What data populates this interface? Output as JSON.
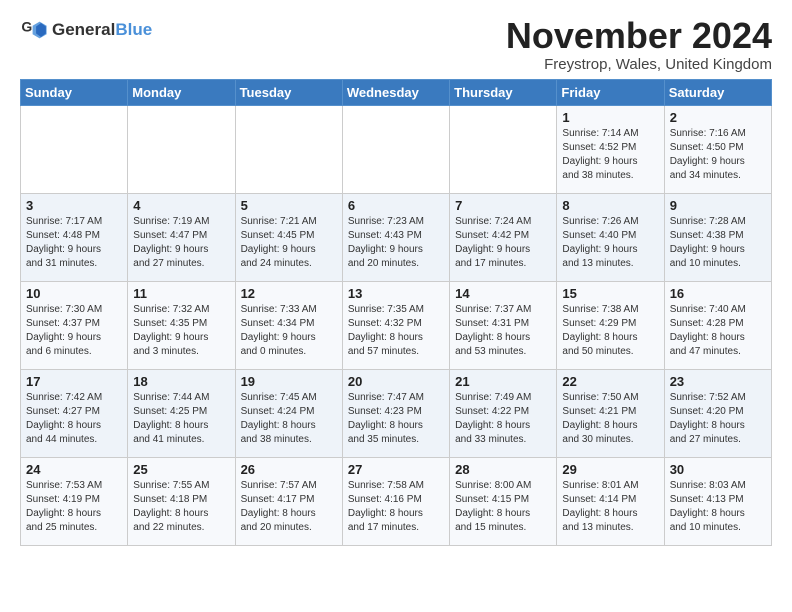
{
  "logo": {
    "line1": "General",
    "line2": "Blue"
  },
  "title": "November 2024",
  "location": "Freystrop, Wales, United Kingdom",
  "weekdays": [
    "Sunday",
    "Monday",
    "Tuesday",
    "Wednesday",
    "Thursday",
    "Friday",
    "Saturday"
  ],
  "weeks": [
    [
      {
        "day": "",
        "info": ""
      },
      {
        "day": "",
        "info": ""
      },
      {
        "day": "",
        "info": ""
      },
      {
        "day": "",
        "info": ""
      },
      {
        "day": "",
        "info": ""
      },
      {
        "day": "1",
        "info": "Sunrise: 7:14 AM\nSunset: 4:52 PM\nDaylight: 9 hours\nand 38 minutes."
      },
      {
        "day": "2",
        "info": "Sunrise: 7:16 AM\nSunset: 4:50 PM\nDaylight: 9 hours\nand 34 minutes."
      }
    ],
    [
      {
        "day": "3",
        "info": "Sunrise: 7:17 AM\nSunset: 4:48 PM\nDaylight: 9 hours\nand 31 minutes."
      },
      {
        "day": "4",
        "info": "Sunrise: 7:19 AM\nSunset: 4:47 PM\nDaylight: 9 hours\nand 27 minutes."
      },
      {
        "day": "5",
        "info": "Sunrise: 7:21 AM\nSunset: 4:45 PM\nDaylight: 9 hours\nand 24 minutes."
      },
      {
        "day": "6",
        "info": "Sunrise: 7:23 AM\nSunset: 4:43 PM\nDaylight: 9 hours\nand 20 minutes."
      },
      {
        "day": "7",
        "info": "Sunrise: 7:24 AM\nSunset: 4:42 PM\nDaylight: 9 hours\nand 17 minutes."
      },
      {
        "day": "8",
        "info": "Sunrise: 7:26 AM\nSunset: 4:40 PM\nDaylight: 9 hours\nand 13 minutes."
      },
      {
        "day": "9",
        "info": "Sunrise: 7:28 AM\nSunset: 4:38 PM\nDaylight: 9 hours\nand 10 minutes."
      }
    ],
    [
      {
        "day": "10",
        "info": "Sunrise: 7:30 AM\nSunset: 4:37 PM\nDaylight: 9 hours\nand 6 minutes."
      },
      {
        "day": "11",
        "info": "Sunrise: 7:32 AM\nSunset: 4:35 PM\nDaylight: 9 hours\nand 3 minutes."
      },
      {
        "day": "12",
        "info": "Sunrise: 7:33 AM\nSunset: 4:34 PM\nDaylight: 9 hours\nand 0 minutes."
      },
      {
        "day": "13",
        "info": "Sunrise: 7:35 AM\nSunset: 4:32 PM\nDaylight: 8 hours\nand 57 minutes."
      },
      {
        "day": "14",
        "info": "Sunrise: 7:37 AM\nSunset: 4:31 PM\nDaylight: 8 hours\nand 53 minutes."
      },
      {
        "day": "15",
        "info": "Sunrise: 7:38 AM\nSunset: 4:29 PM\nDaylight: 8 hours\nand 50 minutes."
      },
      {
        "day": "16",
        "info": "Sunrise: 7:40 AM\nSunset: 4:28 PM\nDaylight: 8 hours\nand 47 minutes."
      }
    ],
    [
      {
        "day": "17",
        "info": "Sunrise: 7:42 AM\nSunset: 4:27 PM\nDaylight: 8 hours\nand 44 minutes."
      },
      {
        "day": "18",
        "info": "Sunrise: 7:44 AM\nSunset: 4:25 PM\nDaylight: 8 hours\nand 41 minutes."
      },
      {
        "day": "19",
        "info": "Sunrise: 7:45 AM\nSunset: 4:24 PM\nDaylight: 8 hours\nand 38 minutes."
      },
      {
        "day": "20",
        "info": "Sunrise: 7:47 AM\nSunset: 4:23 PM\nDaylight: 8 hours\nand 35 minutes."
      },
      {
        "day": "21",
        "info": "Sunrise: 7:49 AM\nSunset: 4:22 PM\nDaylight: 8 hours\nand 33 minutes."
      },
      {
        "day": "22",
        "info": "Sunrise: 7:50 AM\nSunset: 4:21 PM\nDaylight: 8 hours\nand 30 minutes."
      },
      {
        "day": "23",
        "info": "Sunrise: 7:52 AM\nSunset: 4:20 PM\nDaylight: 8 hours\nand 27 minutes."
      }
    ],
    [
      {
        "day": "24",
        "info": "Sunrise: 7:53 AM\nSunset: 4:19 PM\nDaylight: 8 hours\nand 25 minutes."
      },
      {
        "day": "25",
        "info": "Sunrise: 7:55 AM\nSunset: 4:18 PM\nDaylight: 8 hours\nand 22 minutes."
      },
      {
        "day": "26",
        "info": "Sunrise: 7:57 AM\nSunset: 4:17 PM\nDaylight: 8 hours\nand 20 minutes."
      },
      {
        "day": "27",
        "info": "Sunrise: 7:58 AM\nSunset: 4:16 PM\nDaylight: 8 hours\nand 17 minutes."
      },
      {
        "day": "28",
        "info": "Sunrise: 8:00 AM\nSunset: 4:15 PM\nDaylight: 8 hours\nand 15 minutes."
      },
      {
        "day": "29",
        "info": "Sunrise: 8:01 AM\nSunset: 4:14 PM\nDaylight: 8 hours\nand 13 minutes."
      },
      {
        "day": "30",
        "info": "Sunrise: 8:03 AM\nSunset: 4:13 PM\nDaylight: 8 hours\nand 10 minutes."
      }
    ]
  ]
}
